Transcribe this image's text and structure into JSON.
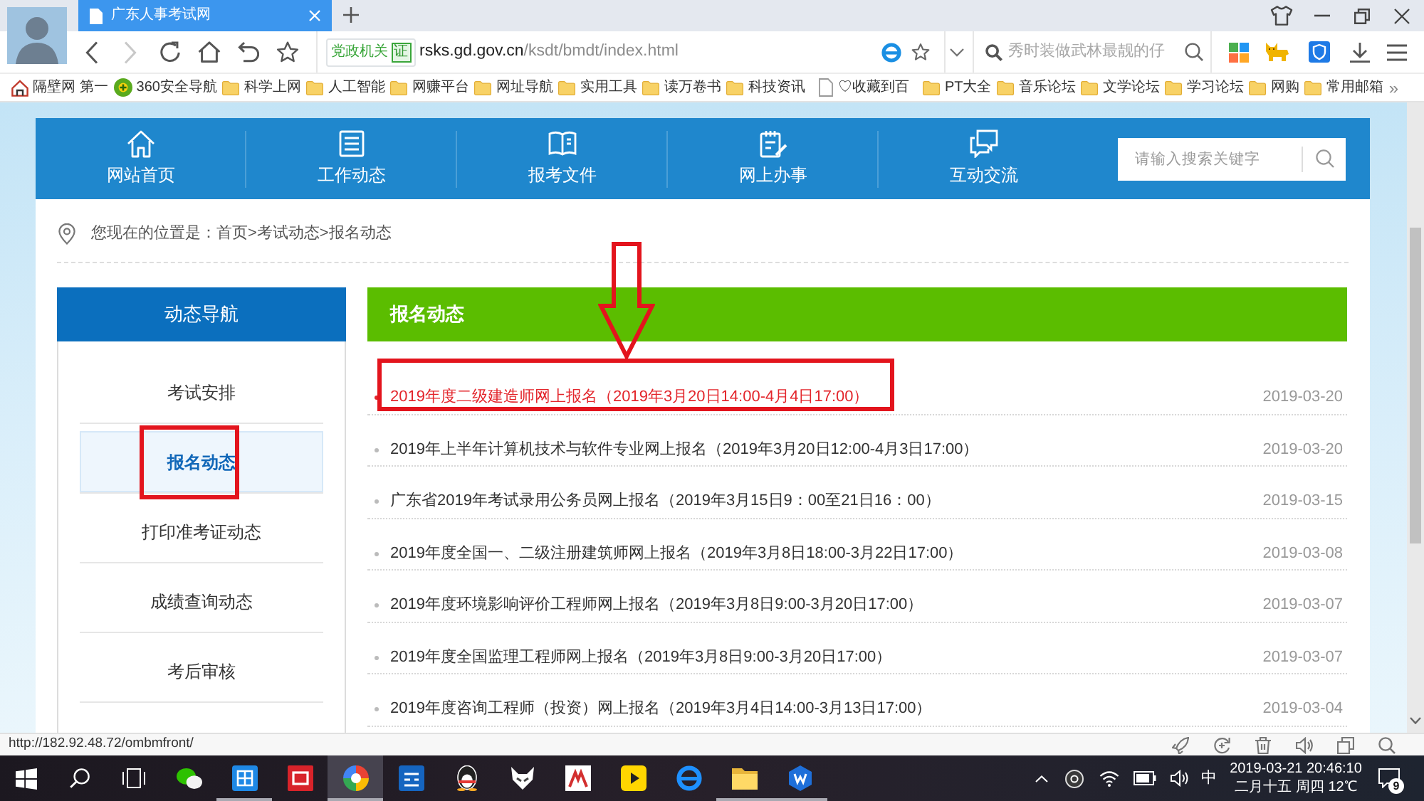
{
  "browser": {
    "tab": {
      "title": "广东人事考试网"
    },
    "forward": {
      "disabled": true
    },
    "address_bar": {
      "badge": "党政机关",
      "badge_seal": "证",
      "domain": "rsks.gd.gov.cn",
      "path": "/ksdt/bmdt/index.html"
    },
    "search": {
      "placeholder": "秀时装做武林最靓的仔"
    },
    "bookmarks": [
      {
        "kind": "house",
        "label": "隔壁网 第一"
      },
      {
        "kind": "disc",
        "label": "360安全导航"
      },
      {
        "kind": "folder",
        "label": "科学上网"
      },
      {
        "kind": "folder",
        "label": "人工智能"
      },
      {
        "kind": "folder",
        "label": "网赚平台"
      },
      {
        "kind": "folder",
        "label": "网址导航"
      },
      {
        "kind": "folder",
        "label": "实用工具"
      },
      {
        "kind": "folder",
        "label": "读万卷书"
      },
      {
        "kind": "folder",
        "label": "科技资讯"
      },
      {
        "kind": "page",
        "label": "♡收藏到百"
      },
      {
        "kind": "folder",
        "label": "PT大全"
      },
      {
        "kind": "folder",
        "label": "音乐论坛"
      },
      {
        "kind": "folder",
        "label": "文学论坛"
      },
      {
        "kind": "folder",
        "label": "学习论坛"
      },
      {
        "kind": "folder",
        "label": "网购"
      },
      {
        "kind": "folder",
        "label": "常用邮箱"
      }
    ],
    "bookmarks_more": "»"
  },
  "site": {
    "nav": [
      {
        "kind": "home",
        "label": "网站首页"
      },
      {
        "kind": "list",
        "label": "工作动态"
      },
      {
        "kind": "book",
        "label": "报考文件"
      },
      {
        "kind": "form",
        "label": "网上办事"
      },
      {
        "kind": "chat",
        "label": "互动交流"
      }
    ],
    "search": {
      "placeholder": "请输入搜索关键字"
    },
    "breadcrumb": "您现在的位置是：首页>考试动态>报名动态",
    "sidebar": {
      "title": "动态导航",
      "items": [
        {
          "label": "考试安排",
          "selected": false,
          "framed": false
        },
        {
          "label": "报名动态",
          "selected": true,
          "framed": true
        },
        {
          "label": "打印准考证动态",
          "selected": false,
          "framed": false
        },
        {
          "label": "成绩查询动态",
          "selected": false,
          "framed": false
        },
        {
          "label": "考后审核",
          "selected": false,
          "framed": false
        }
      ]
    },
    "news": {
      "title": "报名动态",
      "rows": [
        {
          "title": "2019年度二级建造师网上报名（2019年3月20日14:00-4月4日17:00）",
          "date": "2019-03-20",
          "highlighted": true,
          "framed": true
        },
        {
          "title": "2019年上半年计算机技术与软件专业网上报名（2019年3月20日12:00-4月3日17:00）",
          "date": "2019-03-20",
          "highlighted": false,
          "framed": false
        },
        {
          "title": "广东省2019年考试录用公务员网上报名（2019年3月15日9：00至21日16：00）",
          "date": "2019-03-15",
          "highlighted": false,
          "framed": false
        },
        {
          "title": "2019年度全国一、二级注册建筑师网上报名（2019年3月8日18:00-3月22日17:00）",
          "date": "2019-03-08",
          "highlighted": false,
          "framed": false
        },
        {
          "title": "2019年度环境影响评价工程师网上报名（2019年3月8日9:00-3月20日17:00）",
          "date": "2019-03-07",
          "highlighted": false,
          "framed": false
        },
        {
          "title": "2019年度全国监理工程师网上报名（2019年3月8日9:00-3月20日17:00）",
          "date": "2019-03-07",
          "highlighted": false,
          "framed": false
        },
        {
          "title": "2019年度咨询工程师（投资）网上报名（2019年3月4日14:00-3月13日17:00）",
          "date": "2019-03-04",
          "highlighted": false,
          "framed": false
        }
      ]
    }
  },
  "status_bar": {
    "url": "http://182.92.48.72/ombmfront/"
  },
  "taskbar": {
    "apps": [
      {
        "kind": "chat",
        "active": false,
        "running": false
      },
      {
        "kind": "grid",
        "active": false,
        "running": true
      },
      {
        "kind": "tile",
        "active": false,
        "running": false
      },
      {
        "kind": "wheel",
        "active": true,
        "running": true
      },
      {
        "kind": "board",
        "active": false,
        "running": false
      },
      {
        "kind": "penguin",
        "active": false,
        "running": false
      },
      {
        "kind": "fox",
        "active": false,
        "running": false
      },
      {
        "kind": "logo",
        "active": false,
        "running": false
      },
      {
        "kind": "player",
        "active": false,
        "running": false
      },
      {
        "kind": "browser",
        "active": false,
        "running": false
      },
      {
        "kind": "folder",
        "active": false,
        "running": true
      },
      {
        "kind": "hexagon",
        "active": false,
        "running": true
      }
    ],
    "ime": "中",
    "datetime": "2019-03-21 20:46:10",
    "calendar": "二月十五 周四 12℃",
    "notifications": "9"
  }
}
